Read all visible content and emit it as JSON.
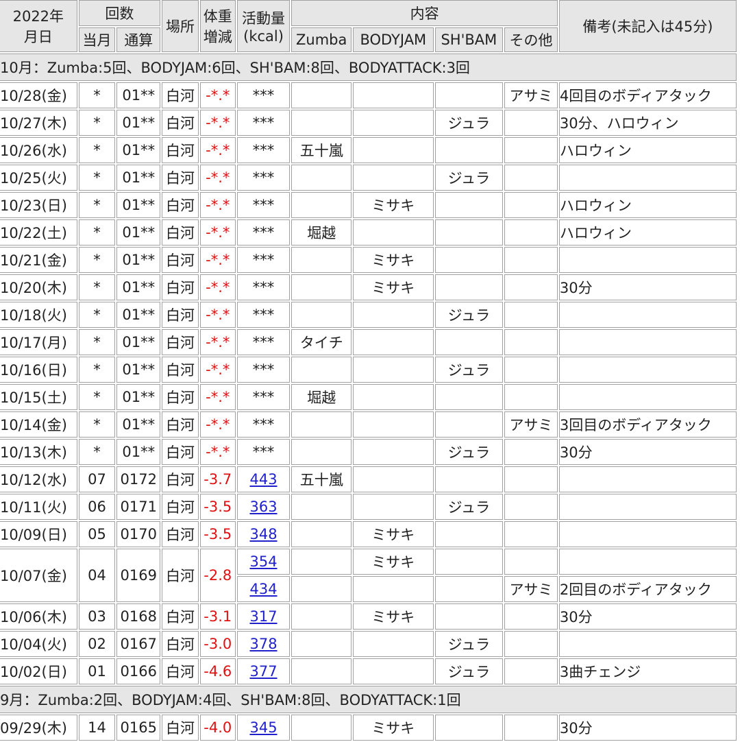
{
  "header": {
    "year": "2022年",
    "day": "月日",
    "count": "回数",
    "month_count": "当月",
    "total_count": "通算",
    "place": "場所",
    "weight1": "体重",
    "weight2": "増減",
    "activity1": "活動量",
    "activity2": "(kcal)",
    "content": "内容",
    "zumba": "Zumba",
    "bodyjam": "BODYJAM",
    "shbam": "SH'BAM",
    "other": "その他",
    "note": "備考(未記入は45分)"
  },
  "month_oct": "10月：Zumba:5回、BODYJAM:6回、SH'BAM:8回、BODYATTACK:3回",
  "month_sep": "9月：Zumba:2回、BODYJAM:4回、SH'BAM:8回、BODYATTACK:1回",
  "rows": [
    {
      "date": "10/28(金)",
      "m": "*",
      "t": "01**",
      "p": "白河",
      "w": "-*.*",
      "k": "***",
      "zumba": "",
      "bodyjam": "",
      "shbam": "",
      "other": "アサミ",
      "note": "4回目のボディアタック"
    },
    {
      "date": "10/27(木)",
      "m": "*",
      "t": "01**",
      "p": "白河",
      "w": "-*.*",
      "k": "***",
      "zumba": "",
      "bodyjam": "",
      "shbam": "ジュラ",
      "other": "",
      "note": "30分、ハロウィン"
    },
    {
      "date": "10/26(水)",
      "m": "*",
      "t": "01**",
      "p": "白河",
      "w": "-*.*",
      "k": "***",
      "zumba": "五十嵐",
      "bodyjam": "",
      "shbam": "",
      "other": "",
      "note": "ハロウィン"
    },
    {
      "date": "10/25(火)",
      "m": "*",
      "t": "01**",
      "p": "白河",
      "w": "-*.*",
      "k": "***",
      "zumba": "",
      "bodyjam": "",
      "shbam": "ジュラ",
      "other": "",
      "note": ""
    },
    {
      "date": "10/23(日)",
      "m": "*",
      "t": "01**",
      "p": "白河",
      "w": "-*.*",
      "k": "***",
      "zumba": "",
      "bodyjam": "ミサキ",
      "shbam": "",
      "other": "",
      "note": "ハロウィン"
    },
    {
      "date": "10/22(土)",
      "m": "*",
      "t": "01**",
      "p": "白河",
      "w": "-*.*",
      "k": "***",
      "zumba": "堀越",
      "bodyjam": "",
      "shbam": "",
      "other": "",
      "note": "ハロウィン"
    },
    {
      "date": "10/21(金)",
      "m": "*",
      "t": "01**",
      "p": "白河",
      "w": "-*.*",
      "k": "***",
      "zumba": "",
      "bodyjam": "ミサキ",
      "shbam": "",
      "other": "",
      "note": ""
    },
    {
      "date": "10/20(木)",
      "m": "*",
      "t": "01**",
      "p": "白河",
      "w": "-*.*",
      "k": "***",
      "zumba": "",
      "bodyjam": "ミサキ",
      "shbam": "",
      "other": "",
      "note": "30分"
    },
    {
      "date": "10/18(火)",
      "m": "*",
      "t": "01**",
      "p": "白河",
      "w": "-*.*",
      "k": "***",
      "zumba": "",
      "bodyjam": "",
      "shbam": "ジュラ",
      "other": "",
      "note": ""
    },
    {
      "date": "10/17(月)",
      "m": "*",
      "t": "01**",
      "p": "白河",
      "w": "-*.*",
      "k": "***",
      "zumba": "タイチ",
      "bodyjam": "",
      "shbam": "",
      "other": "",
      "note": ""
    },
    {
      "date": "10/16(日)",
      "m": "*",
      "t": "01**",
      "p": "白河",
      "w": "-*.*",
      "k": "***",
      "zumba": "",
      "bodyjam": "",
      "shbam": "ジュラ",
      "other": "",
      "note": ""
    },
    {
      "date": "10/15(土)",
      "m": "*",
      "t": "01**",
      "p": "白河",
      "w": "-*.*",
      "k": "***",
      "zumba": "堀越",
      "bodyjam": "",
      "shbam": "",
      "other": "",
      "note": ""
    },
    {
      "date": "10/14(金)",
      "m": "*",
      "t": "01**",
      "p": "白河",
      "w": "-*.*",
      "k": "***",
      "zumba": "",
      "bodyjam": "",
      "shbam": "",
      "other": "アサミ",
      "note": "3回目のボディアタック"
    },
    {
      "date": "10/13(木)",
      "m": "*",
      "t": "01**",
      "p": "白河",
      "w": "-*.*",
      "k": "***",
      "zumba": "",
      "bodyjam": "",
      "shbam": "ジュラ",
      "other": "",
      "note": "30分"
    },
    {
      "date": "10/12(水)",
      "m": "07",
      "t": "0172",
      "p": "白河",
      "w": "-3.7",
      "k": "443",
      "zumba": "五十嵐",
      "bodyjam": "",
      "shbam": "",
      "other": "",
      "note": ""
    },
    {
      "date": "10/11(火)",
      "m": "06",
      "t": "0171",
      "p": "白河",
      "w": "-3.5",
      "k": "363",
      "zumba": "",
      "bodyjam": "",
      "shbam": "ジュラ",
      "other": "",
      "note": ""
    },
    {
      "date": "10/09(日)",
      "m": "05",
      "t": "0170",
      "p": "白河",
      "w": "-3.5",
      "k": "348",
      "zumba": "",
      "bodyjam": "ミサキ",
      "shbam": "",
      "other": "",
      "note": ""
    }
  ],
  "row_oct07": {
    "date": "10/07(金)",
    "m": "04",
    "t": "0169",
    "p": "白河",
    "w": "-2.8",
    "a": {
      "k": "354",
      "zumba": "",
      "bodyjam": "ミサキ",
      "shbam": "",
      "other": "",
      "note": ""
    },
    "b": {
      "k": "434",
      "zumba": "",
      "bodyjam": "",
      "shbam": "",
      "other": "アサミ",
      "note": "2回目のボディアタック"
    }
  },
  "rows_after": [
    {
      "date": "10/06(木)",
      "m": "03",
      "t": "0168",
      "p": "白河",
      "w": "-3.1",
      "k": "317",
      "zumba": "",
      "bodyjam": "ミサキ",
      "shbam": "",
      "other": "",
      "note": "30分"
    },
    {
      "date": "10/04(火)",
      "m": "02",
      "t": "0167",
      "p": "白河",
      "w": "-3.0",
      "k": "378",
      "zumba": "",
      "bodyjam": "",
      "shbam": "ジュラ",
      "other": "",
      "note": ""
    },
    {
      "date": "10/02(日)",
      "m": "01",
      "t": "0166",
      "p": "白河",
      "w": "-4.6",
      "k": "377",
      "zumba": "",
      "bodyjam": "",
      "shbam": "ジュラ",
      "other": "",
      "note": "3曲チェンジ"
    }
  ],
  "rows_sep": [
    {
      "date": "09/29(木)",
      "m": "14",
      "t": "0165",
      "p": "白河",
      "w": "-4.0",
      "k": "345",
      "zumba": "",
      "bodyjam": "ミサキ",
      "shbam": "",
      "other": "",
      "note": "30分"
    }
  ]
}
